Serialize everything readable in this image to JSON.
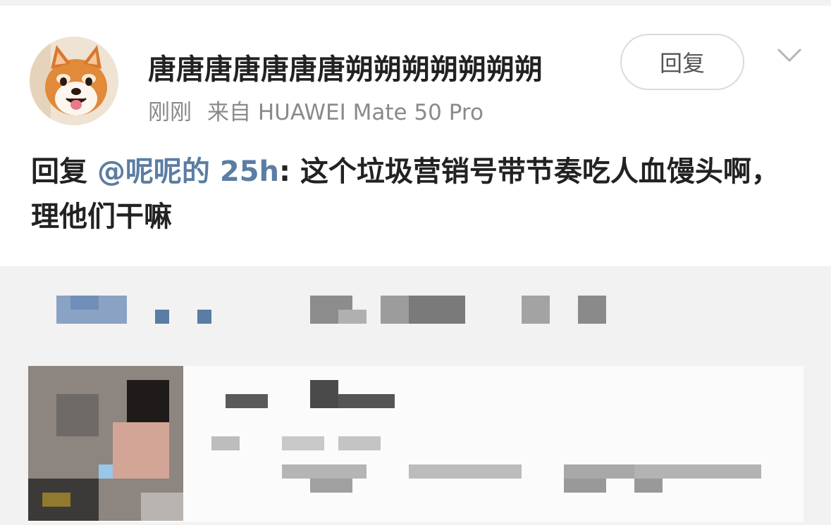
{
  "comment": {
    "username": "唐唐唐唐唐唐唐朔朔朔朔朔朔朔",
    "time": "刚刚",
    "source": "来自 HUAWEI Mate 50 Pro",
    "reply_button": "回复",
    "content": {
      "prefix": "回复 ",
      "mention": "@呢呢的 25h",
      "text": ": 这个垃圾营销号带节奏吃人血馒头啊，理他们干嘛"
    }
  },
  "icons": {
    "avatar": "shiba-dog-avatar",
    "more": "chevron-down-icon"
  },
  "colors": {
    "mention": "#5b7da3",
    "background": "#f2f2f2",
    "card": "#ffffff"
  }
}
